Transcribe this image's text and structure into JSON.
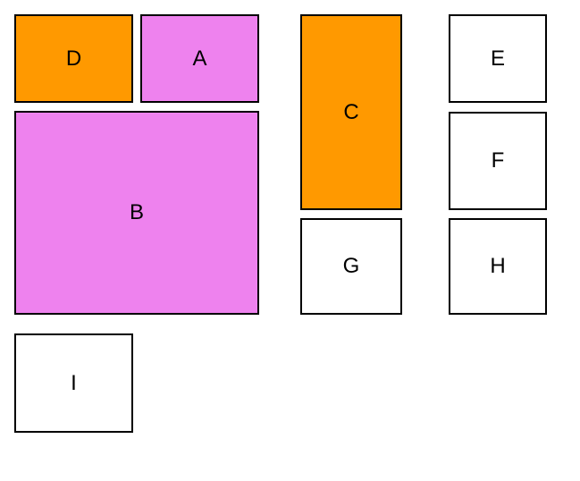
{
  "boxes": {
    "d": {
      "label": "D"
    },
    "a": {
      "label": "A"
    },
    "b": {
      "label": "B"
    },
    "c": {
      "label": "C"
    },
    "e": {
      "label": "E"
    },
    "f": {
      "label": "F"
    },
    "g": {
      "label": "G"
    },
    "h": {
      "label": "H"
    },
    "i": {
      "label": "I"
    }
  }
}
